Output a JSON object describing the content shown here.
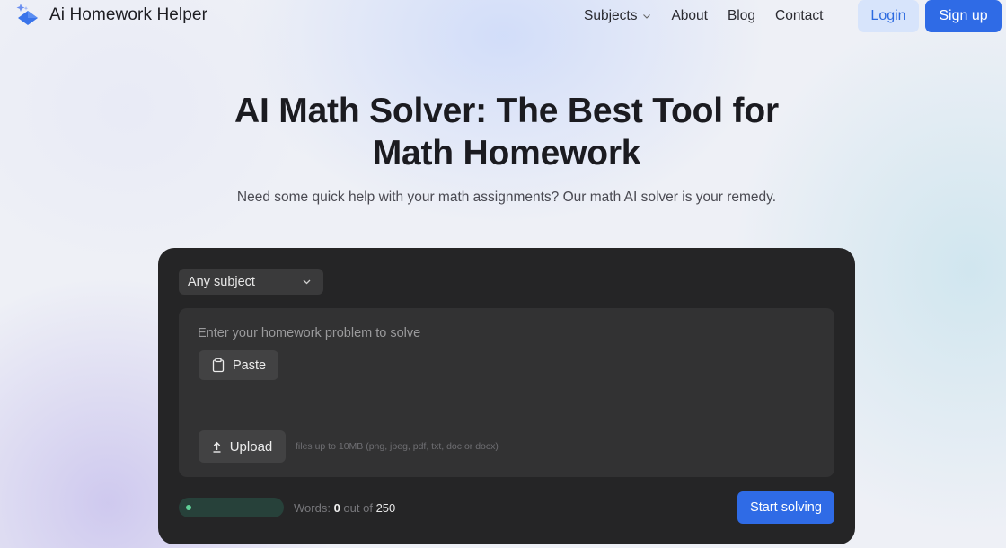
{
  "brand": {
    "name": "Ai Homework Helper",
    "logo_icon": "sparkle-diamond-icon",
    "accent": "#3a74ea"
  },
  "nav": {
    "items": [
      {
        "label": "Subjects",
        "has_dropdown": true
      },
      {
        "label": "About"
      },
      {
        "label": "Blog"
      },
      {
        "label": "Contact"
      }
    ],
    "login_label": "Login",
    "signup_label": "Sign up"
  },
  "hero": {
    "title_line1": "AI Math Solver: The Best Tool for",
    "title_line2": "Math Homework",
    "subtitle": "Need some quick help with your math assignments? Our math AI solver is your remedy."
  },
  "solver": {
    "subject_select": {
      "value": "Any subject",
      "icon": "chevron-down-icon"
    },
    "problem_input": {
      "value": "",
      "placeholder": "Enter your homework problem to solve"
    },
    "paste_label": "Paste",
    "paste_icon": "clipboard-icon",
    "upload_label": "Upload",
    "upload_icon": "upload-arrow-icon",
    "upload_hint": "files up to 10MB (png, jpeg, pdf, txt, doc or docx)",
    "word_count": {
      "prefix": "Words:",
      "current": "0",
      "separator": "out of",
      "max": "250",
      "progress": 0
    },
    "start_label": "Start solving",
    "colors": {
      "panel": "#252526",
      "primary": "#2f6be6",
      "progress_dot": "#5fd197"
    }
  }
}
